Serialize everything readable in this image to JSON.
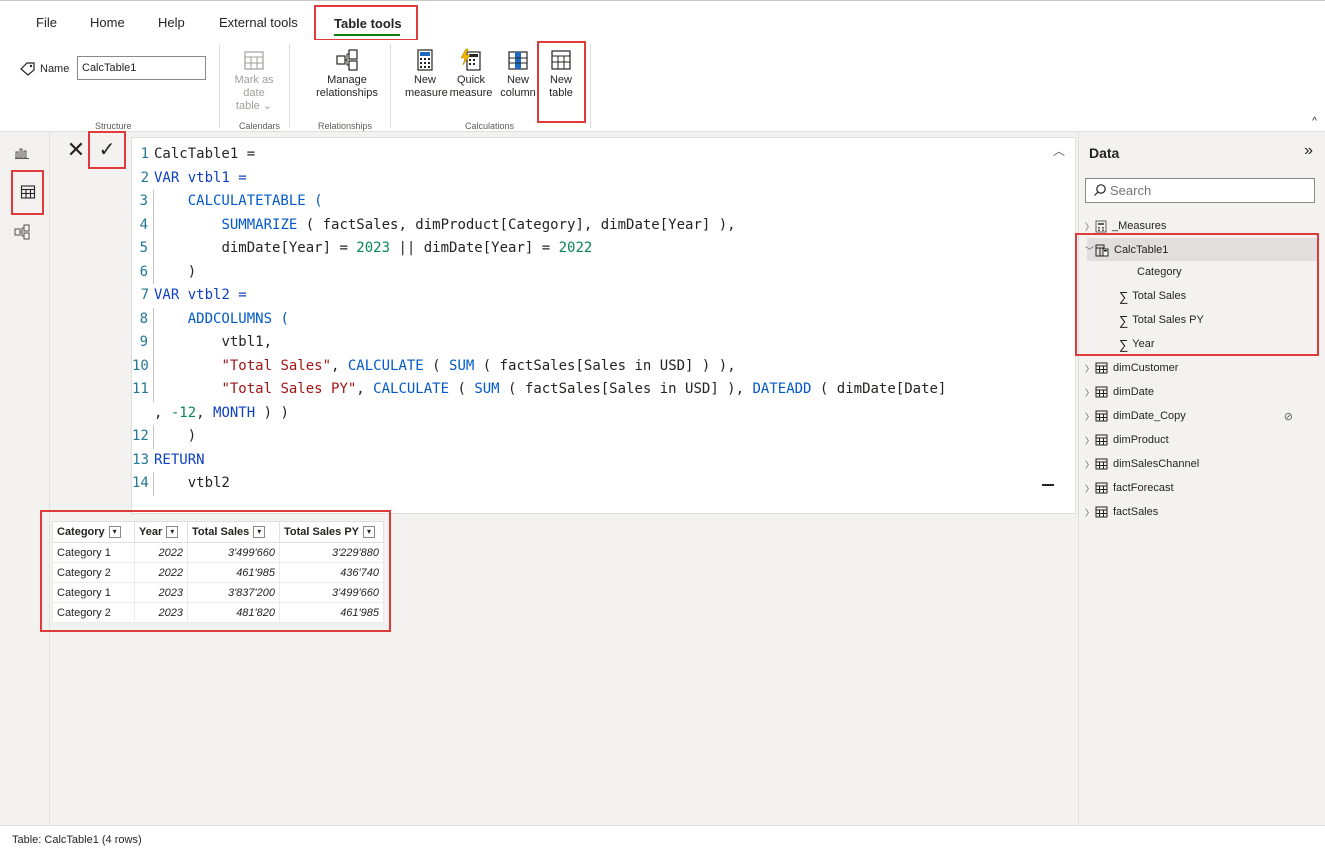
{
  "menu": {
    "file": "File",
    "home": "Home",
    "help": "Help",
    "external_tools": "External tools",
    "table_tools": "Table tools"
  },
  "ribbon": {
    "name_label": "Name",
    "name_value": "CalcTable1",
    "mark_as_date_line1": "Mark as date",
    "mark_as_date_line2": "table",
    "manage_rel_line1": "Manage",
    "manage_rel_line2": "relationships",
    "new_measure_line1": "New",
    "new_measure_line2": "measure",
    "quick_measure_line1": "Quick",
    "quick_measure_line2": "measure",
    "new_column_line1": "New",
    "new_column_line2": "column",
    "new_table_line1": "New",
    "new_table_line2": "table",
    "groups": {
      "structure": "Structure",
      "calendars": "Calendars",
      "relationships": "Relationships",
      "calculations": "Calculations"
    }
  },
  "editor": {
    "lines": [
      {
        "n": "1",
        "text": "CalcTable1 ="
      },
      {
        "n": "2",
        "text": "VAR vtbl1 ="
      },
      {
        "n": "3",
        "text": "CALCULATETABLE ("
      },
      {
        "n": "4",
        "text": "SUMMARIZE ( factSales, dimProduct[Category], dimDate[Year] ),"
      },
      {
        "n": "5",
        "text": "dimDate[Year] = 2023 || dimDate[Year] = 2022"
      },
      {
        "n": "6",
        "text": ")"
      },
      {
        "n": "7",
        "text": "VAR vtbl2 ="
      },
      {
        "n": "8",
        "text": "ADDCOLUMNS ("
      },
      {
        "n": "9",
        "text": "vtbl1,"
      },
      {
        "n": "10",
        "text": "\"Total Sales\", CALCULATE ( SUM ( factSales[Sales in USD] ) ),"
      },
      {
        "n": "11",
        "text": "\"Total Sales PY\", CALCULATE ( SUM ( factSales[Sales in USD] ), DATEADD ( dimDate[Date]"
      },
      {
        "n": "",
        "text": ", -12, MONTH ) )"
      },
      {
        "n": "12",
        "text": ")"
      },
      {
        "n": "13",
        "text": "RETURN"
      },
      {
        "n": "14",
        "text": "vtbl2"
      }
    ]
  },
  "table": {
    "headers": [
      "Category",
      "Year",
      "Total Sales",
      "Total Sales PY"
    ],
    "rows": [
      [
        "Category 1",
        "2022",
        "3'499'660",
        "3'229'880"
      ],
      [
        "Category 2",
        "2022",
        "461'985",
        "436'740"
      ],
      [
        "Category 1",
        "2023",
        "3'837'200",
        "3'499'660"
      ],
      [
        "Category 2",
        "2023",
        "481'820",
        "461'985"
      ]
    ]
  },
  "data_pane": {
    "title": "Data",
    "search_placeholder": "Search",
    "tables": {
      "measures": "_Measures",
      "calctable": "CalcTable1",
      "dimcustomer": "dimCustomer",
      "dimdate": "dimDate",
      "dimdate_copy": "dimDate_Copy",
      "dimproduct": "dimProduct",
      "dimsaleschannel": "dimSalesChannel",
      "factforecast": "factForecast",
      "factsales": "factSales"
    },
    "calc_fields": {
      "category": "Category",
      "total_sales": "Total Sales",
      "total_sales_py": "Total Sales PY",
      "year": "Year"
    }
  },
  "status": {
    "text": "Table: CalcTable1 (4 rows)"
  },
  "colors": {
    "highlight": "#e03b3b",
    "accent_underline": "#107c10",
    "keyword": "#0f40c0",
    "string": "#a31515",
    "number": "#098658"
  }
}
